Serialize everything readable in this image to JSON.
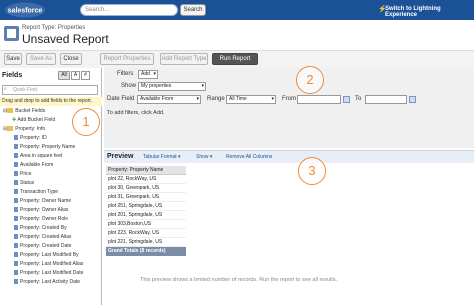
{
  "app": {
    "logo_text": "salesforce",
    "search_placeholder": "Search...",
    "search_button": "Search",
    "lightning_link": "Switch to Lightning Experience"
  },
  "report": {
    "type_label": "Report Type: Properties",
    "title": "Unsaved Report"
  },
  "toolbar": {
    "save": "Save",
    "save_as": "Save As",
    "close": "Close",
    "report_properties": "Report Properties",
    "add_report_type": "Add Report Type",
    "run_report": "Run Report"
  },
  "sidebar": {
    "title": "Fields",
    "filter_buttons": [
      "All",
      "A",
      "#"
    ],
    "quick_find_placeholder": "Quick Find",
    "hint": "Drag and drop to add fields to the report.",
    "bucket_folder": "Bucket Fields",
    "add_bucket_field": "Add Bucket Field",
    "property_folder": "Property: Info",
    "fields": [
      "Property: ID",
      "Property: Property Name",
      "Area in square feet",
      "Available From",
      "Price",
      "Status",
      "Transaction Type",
      "Property: Owner Name",
      "Property: Owner Alias",
      "Property: Owner Role",
      "Property: Created By",
      "Property: Created Alias",
      "Property: Created Date",
      "Property: Last Modified By",
      "Property: Last Modified Alias",
      "Property: Last Modified Date",
      "Property: Last Activity Date"
    ]
  },
  "filters": {
    "filters_label": "Filters",
    "add_label": "Add",
    "show_label": "Show",
    "show_value": "My properties",
    "date_field_label": "Date Field",
    "date_field_value": "Available From",
    "range_label": "Range",
    "range_value": "All Time",
    "from_label": "From",
    "to_label": "To",
    "empty_text": "To add filters, click Add."
  },
  "preview": {
    "title": "Preview",
    "format": "Tabular Format",
    "show": "Show",
    "remove_all": "Remove All Columns",
    "column_header": "Property: Property Name",
    "rows": [
      "plot 22, RockWay, US",
      "plot 30, Greenpark, US",
      "plot 31, Greenpark, US",
      "plot 251, Springdale, US",
      "plot 201, Springdale, US",
      "plot 303,Boston,US",
      "plot 223, RockWay, US",
      "plot 221, Springdale, US"
    ],
    "grand_totals": "Grand Totals (8 records)",
    "note": "This preview shows a limited number of records. Run the report to see all results."
  },
  "callouts": [
    "1",
    "2",
    "3"
  ],
  "colors": {
    "header_blue": "#1b5297",
    "callout_orange": "#f08a3a",
    "hint_yellow": "#fff7c8"
  }
}
